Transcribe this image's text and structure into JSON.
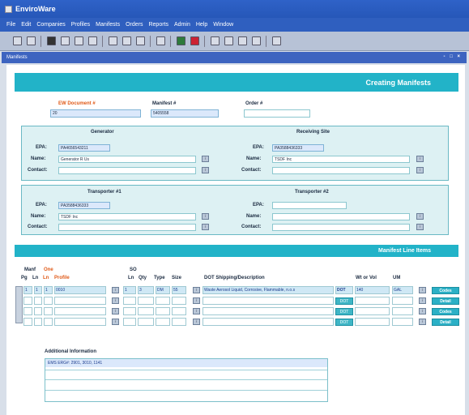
{
  "app": {
    "title": "EnviroWare",
    "subwindow": "Manifests",
    "window_controls": "- □ ×"
  },
  "menu": [
    "File",
    "Edit",
    "Companies",
    "Profiles",
    "Manifests",
    "Orders",
    "Reports",
    "Admin",
    "Help",
    "Window"
  ],
  "header": {
    "banner": "Creating Manifests",
    "ew_doc_label": "EW Document #",
    "ew_doc_value": "20",
    "manifest_label": "Manifest #",
    "manifest_value": "5405558",
    "order_label": "Order #",
    "order_value": ""
  },
  "generator": {
    "title": "Generator",
    "epa_label": "EPA:",
    "epa_value": "PA4656543211",
    "name_label": "Name:",
    "name_value": "Generator R Us",
    "contact_label": "Contact:",
    "contact_value": ""
  },
  "receiving": {
    "title": "Receiving Site",
    "epa_label": "EPA:",
    "epa_value": "PA3588436333",
    "name_label": "Name:",
    "name_value": "TSDF Inc",
    "contact_label": "Contact:",
    "contact_value": ""
  },
  "transporter1": {
    "title": "Transporter #1",
    "epa_label": "EPA:",
    "epa_value": "PA3588436333",
    "name_label": "Name:",
    "name_value": "TSDF Inc",
    "contact_label": "Contact:",
    "contact_value": ""
  },
  "transporter2": {
    "title": "Transporter #2",
    "epa_label": "EPA:",
    "epa_value": "",
    "name_label": "Name:",
    "name_value": "",
    "contact_label": "Contact:",
    "contact_value": ""
  },
  "lineitems": {
    "banner": "Manifest Line Items",
    "manf": "Manf",
    "one": "One",
    "so": "SO",
    "pg": "Pg",
    "ln": "Ln",
    "ln2": "Ln",
    "profile": "Profile",
    "ln3": "Ln",
    "qty": "Qty",
    "type": "Type",
    "size": "Size",
    "dot_desc": "DOT Shipping/Description",
    "wt": "Wt or Vol",
    "um": "UM",
    "row1": {
      "pg": "1",
      "ln": "1",
      "ln2": "1",
      "profile": "0010",
      "soln": "1",
      "qty": "3",
      "type": "DM",
      "size": "55",
      "desc": "Waste Aerosol Liquid, Corrosive, Flammable, n.o.s",
      "dot": "DOT",
      "wt": "140",
      "um": "GAL"
    },
    "buttons": {
      "codes": "Codes",
      "dot": "DOT",
      "detail": "Detail",
      "btn_codes": "Codes"
    }
  },
  "additional": {
    "label": "Additional Information",
    "line1": "EMS ERG#: 2901, 3010, 1141"
  }
}
